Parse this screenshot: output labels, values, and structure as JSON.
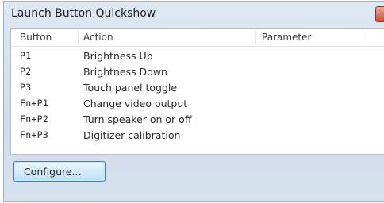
{
  "window": {
    "title": "Launch Button Quickshow"
  },
  "table": {
    "columns": [
      "Button",
      "Action",
      "Parameter"
    ],
    "rows": [
      {
        "button": "P1",
        "action": "Brightness Up",
        "parameter": ""
      },
      {
        "button": "P2",
        "action": "Brightness Down",
        "parameter": ""
      },
      {
        "button": "P3",
        "action": "Touch panel toggle",
        "parameter": ""
      },
      {
        "button": "Fn+P1",
        "action": "Change video output",
        "parameter": ""
      },
      {
        "button": "Fn+P2",
        "action": "Turn speaker on or off",
        "parameter": ""
      },
      {
        "button": "Fn+P3",
        "action": "Digitizer calibration",
        "parameter": ""
      }
    ]
  },
  "footer": {
    "configure_label": "Configure..."
  }
}
